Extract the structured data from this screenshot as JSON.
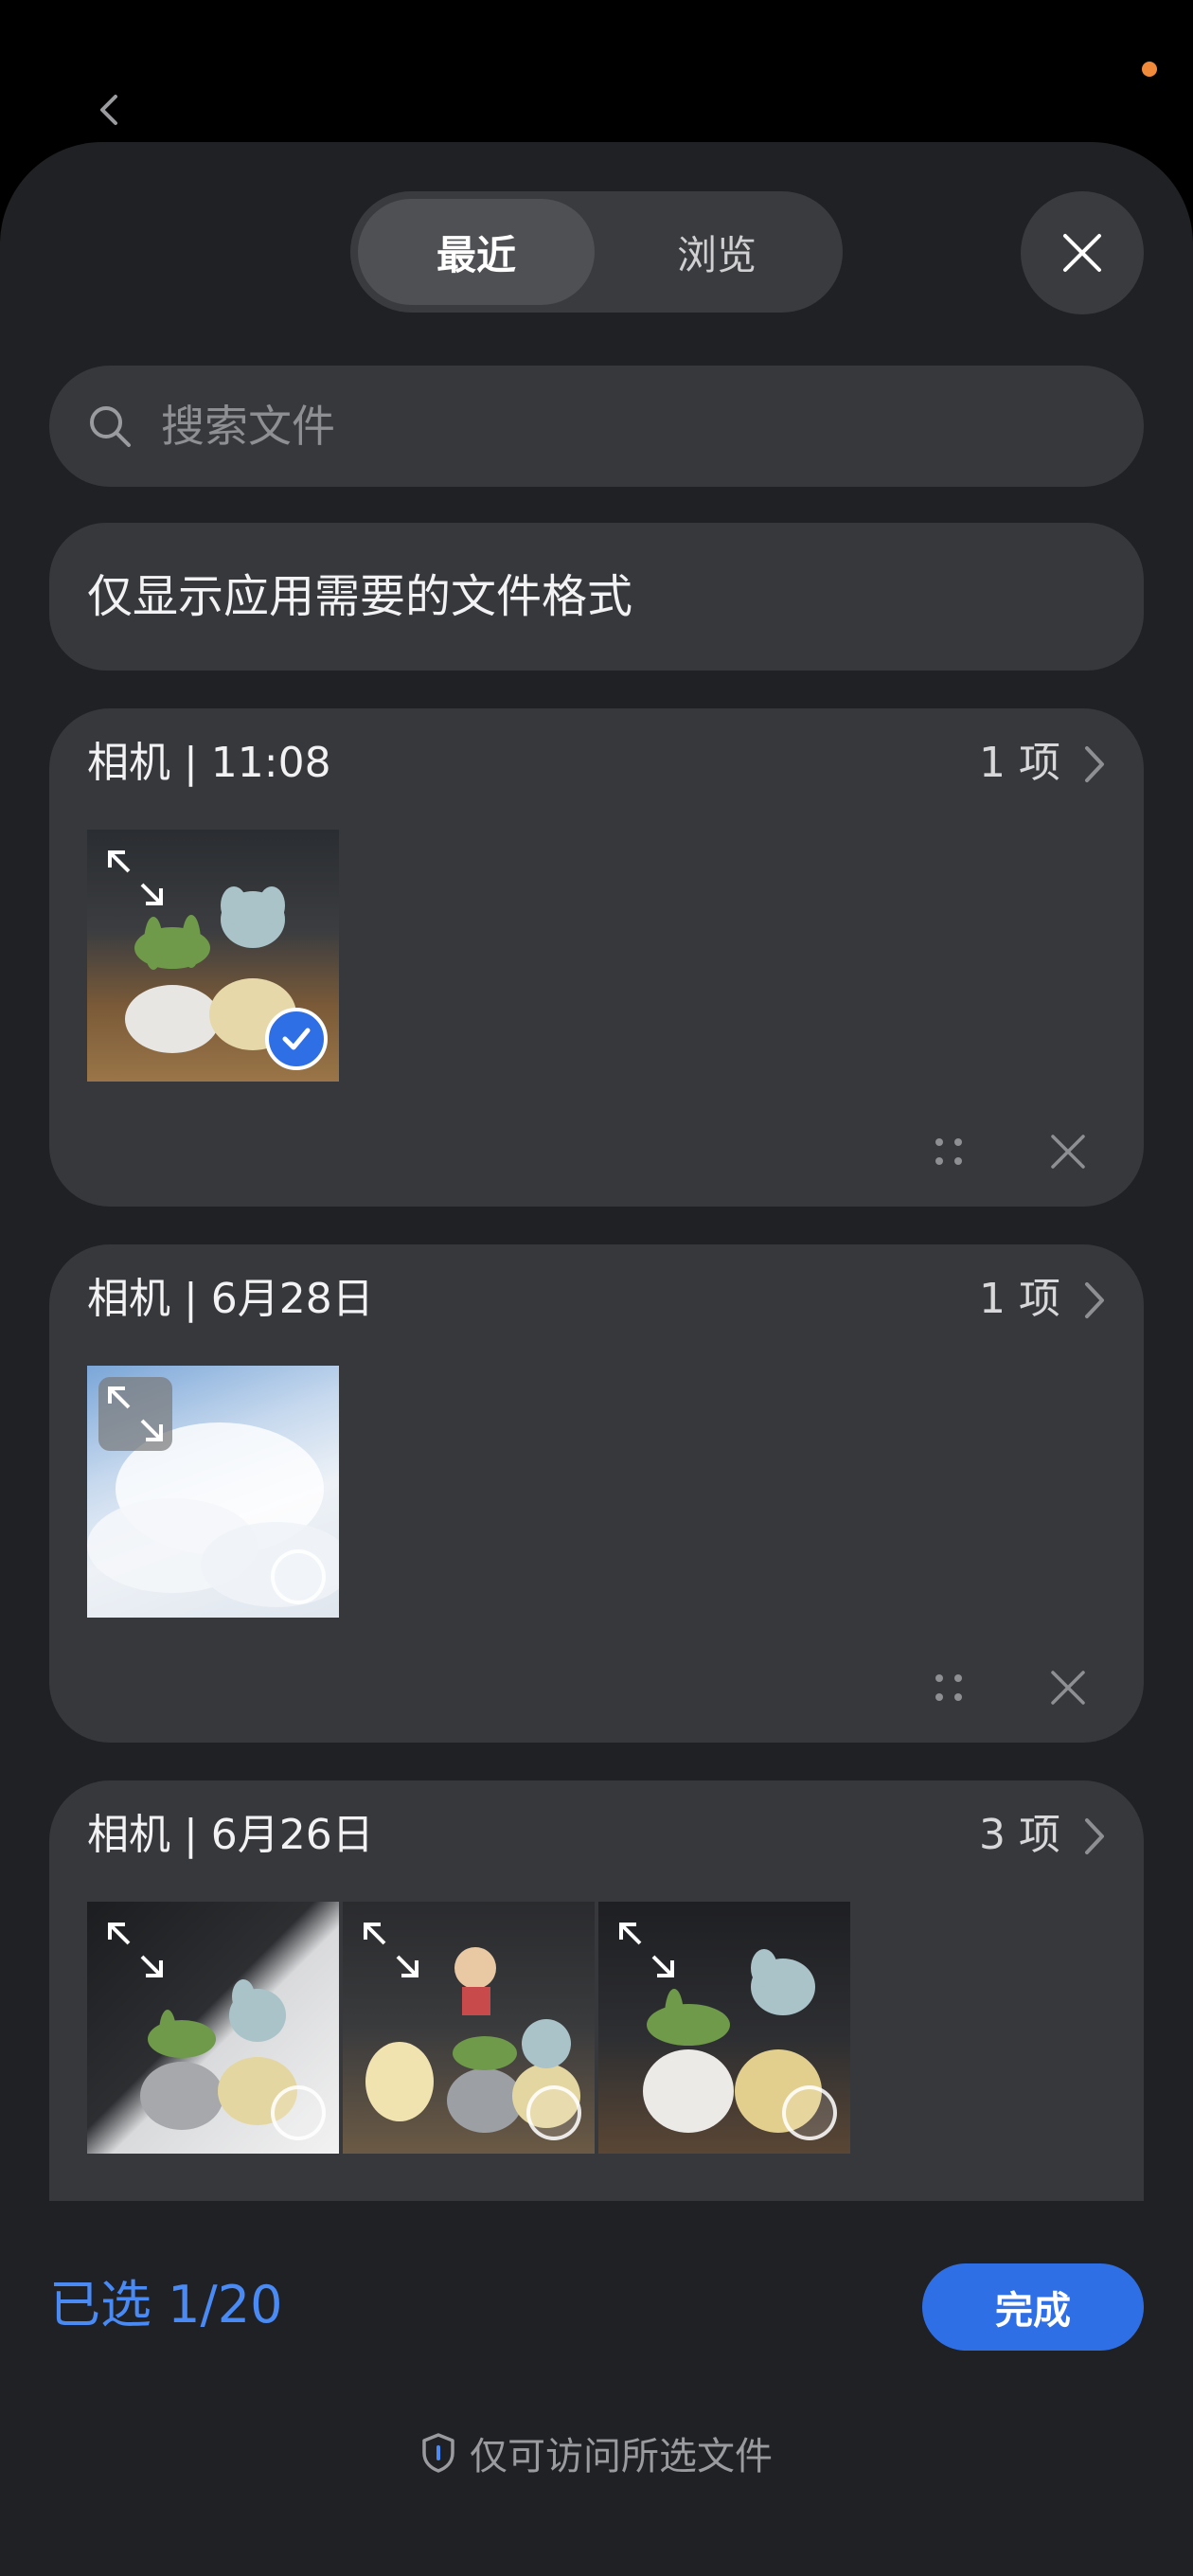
{
  "segmented": {
    "recent_label": "最近",
    "browse_label": "浏览"
  },
  "search": {
    "placeholder": "搜索文件"
  },
  "filter": {
    "label": "仅显示应用需要的文件格式"
  },
  "groups": [
    {
      "title": "相机 | 11:08",
      "count": "1 项",
      "items": [
        {
          "selected": true
        }
      ]
    },
    {
      "title": "相机 | 6月28日",
      "count": "1 项",
      "items": [
        {
          "selected": false
        }
      ]
    },
    {
      "title": "相机 | 6月26日",
      "count": "3 项",
      "items": [
        {
          "selected": false
        },
        {
          "selected": false
        },
        {
          "selected": false
        }
      ]
    }
  ],
  "footer": {
    "selected_text": "已选 1/20",
    "done_label": "完成",
    "privacy_text": "仅可访问所选文件"
  },
  "colors": {
    "accent": "#2f6fe6",
    "accent_text": "#4a8af4",
    "notification_dot": "#f08a3a"
  }
}
